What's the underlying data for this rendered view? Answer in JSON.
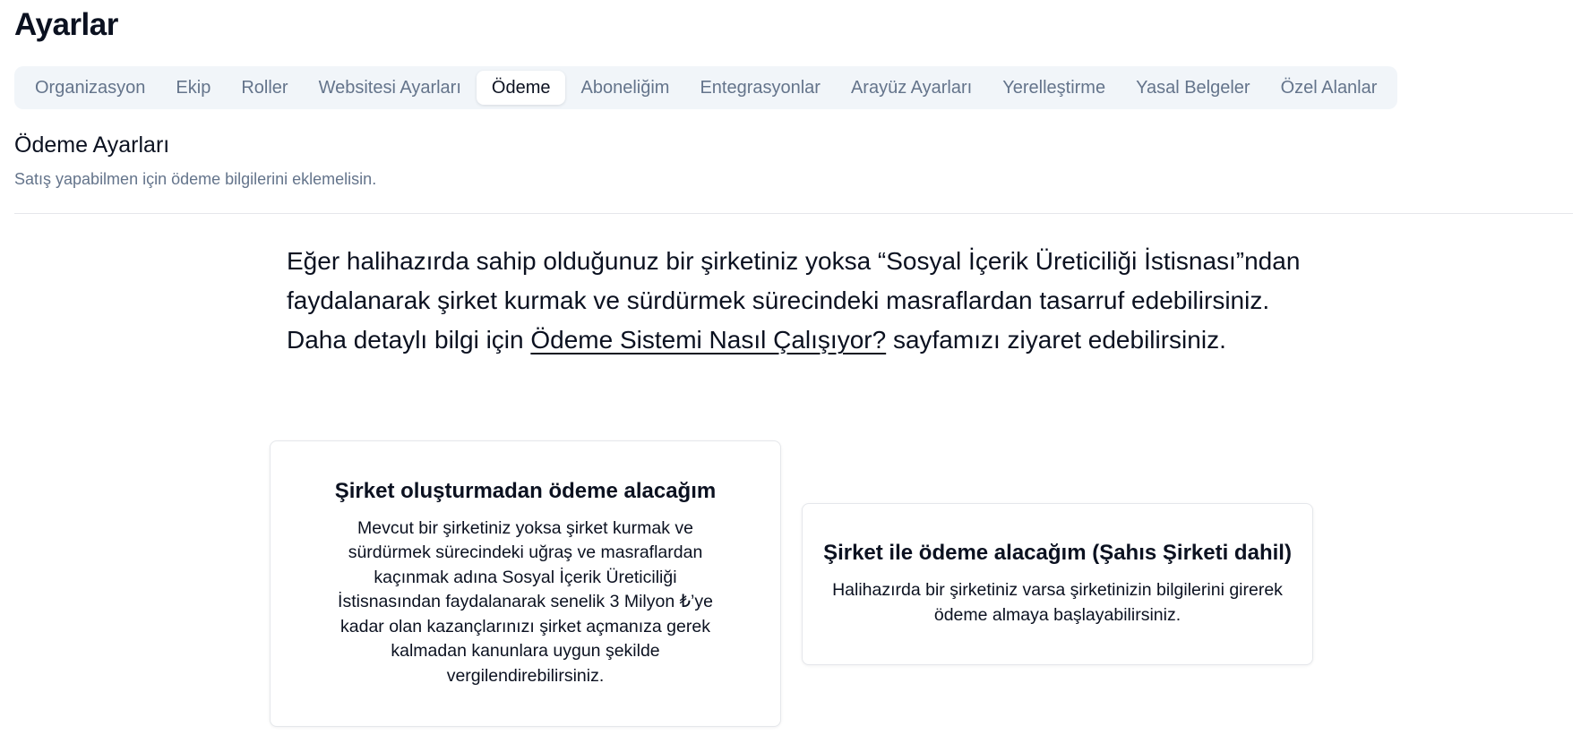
{
  "page": {
    "title": "Ayarlar"
  },
  "tabs": [
    {
      "label": "Organizasyon",
      "active": false
    },
    {
      "label": "Ekip",
      "active": false
    },
    {
      "label": "Roller",
      "active": false
    },
    {
      "label": "Websitesi Ayarları",
      "active": false
    },
    {
      "label": "Ödeme",
      "active": true
    },
    {
      "label": "Aboneliğim",
      "active": false
    },
    {
      "label": "Entegrasyonlar",
      "active": false
    },
    {
      "label": "Arayüz Ayarları",
      "active": false
    },
    {
      "label": "Yerelleştirme",
      "active": false
    },
    {
      "label": "Yasal Belgeler",
      "active": false
    },
    {
      "label": "Özel Alanlar",
      "active": false
    }
  ],
  "section": {
    "title": "Ödeme Ayarları",
    "subtitle": "Satış yapabilmen için ödeme bilgilerini eklemelisin."
  },
  "info": {
    "text_before": "Eğer halihazırda sahip olduğunuz bir şirketiniz yoksa “Sosyal İçerik Üreticiliği İstisnası”ndan faydalanarak şirket kurmak ve sürdürmek sürecindeki masraflardan tasarruf edebilirsiniz. Daha detaylı bilgi için ",
    "link_text": "Ödeme Sistemi Nasıl Çalışıyor?",
    "text_after": " sayfamızı ziyaret edebilirsiniz."
  },
  "options": {
    "without_company": {
      "title": "Şirket oluşturmadan ödeme alacağım",
      "description": "Mevcut bir şirketiniz yoksa şirket kurmak ve sürdürmek sürecindeki uğraş ve masraflardan kaçınmak adına Sosyal İçerik Üreticiliği İstisnasından faydalanarak senelik 3 Milyon ₺’ye kadar olan kazançlarınızı şirket açmanıza gerek kalmadan kanunlara uygun şekilde vergilendirebilirsiniz."
    },
    "with_company": {
      "title": "Şirket ile ödeme alacağım (Şahıs Şirketi dahil)",
      "description": "Halihazırda bir şirketiniz varsa şirketinizin bilgilerini girerek ödeme almaya başlayabilirsiniz."
    }
  },
  "colors": {
    "text_primary": "#0b1120",
    "text_muted": "#64748b",
    "tabs_background": "#f1f5f9",
    "border": "#e5e7eb"
  }
}
